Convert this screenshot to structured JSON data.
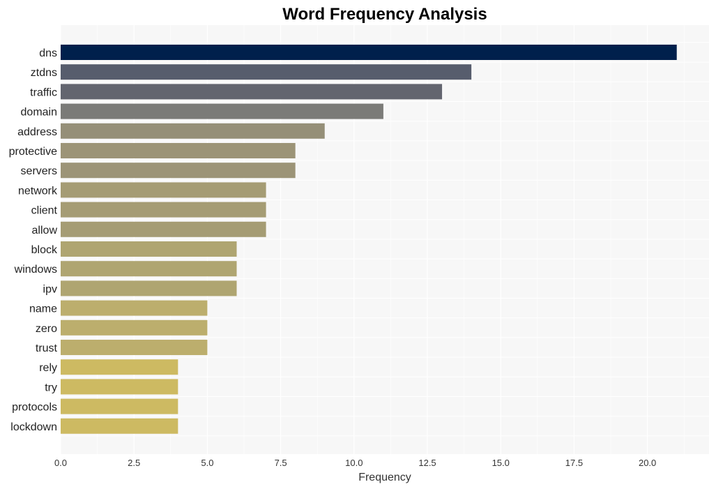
{
  "chart_data": {
    "type": "bar",
    "orientation": "horizontal",
    "title": "Word Frequency Analysis",
    "xlabel": "Frequency",
    "ylabel": "",
    "categories": [
      "dns",
      "ztdns",
      "traffic",
      "domain",
      "address",
      "protective",
      "servers",
      "network",
      "client",
      "allow",
      "block",
      "windows",
      "ipv",
      "name",
      "zero",
      "trust",
      "rely",
      "try",
      "protocols",
      "lockdown"
    ],
    "values": [
      21,
      14,
      13,
      11,
      9,
      8,
      8,
      7,
      7,
      7,
      6,
      6,
      6,
      5,
      5,
      5,
      4,
      4,
      4,
      4
    ],
    "colors": [
      "#00204c",
      "#575d6d",
      "#63656f",
      "#7b7b78",
      "#958f78",
      "#9c9477",
      "#9c9477",
      "#a59c74",
      "#a59c74",
      "#a59c74",
      "#afa571",
      "#afa571",
      "#afa571",
      "#bcae6d",
      "#bcae6d",
      "#bcae6d",
      "#cdba62",
      "#cdba62",
      "#cdba62",
      "#cdba62"
    ],
    "xlim": [
      0,
      22.1
    ],
    "xticks": [
      0,
      2.5,
      5,
      7.5,
      10,
      12.5,
      15,
      17.5,
      20
    ],
    "xtick_labels": [
      "0.0",
      "2.5",
      "5.0",
      "7.5",
      "10.0",
      "12.5",
      "15.0",
      "17.5",
      "20.0"
    ],
    "grid": true,
    "background": "#f7f7f7"
  }
}
